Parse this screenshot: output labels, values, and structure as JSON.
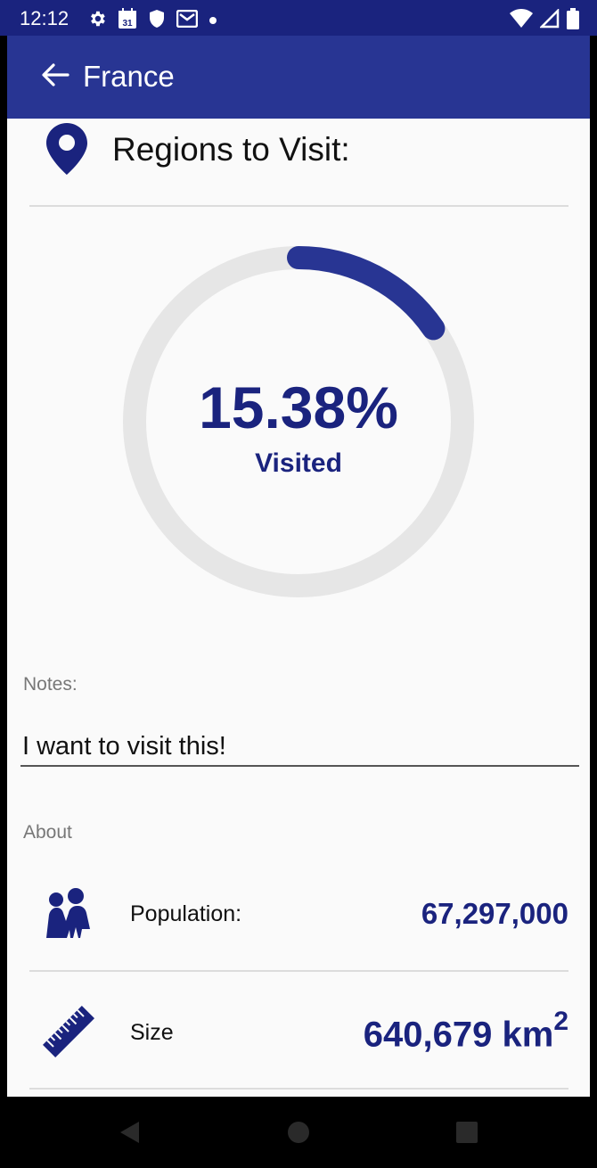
{
  "status_bar": {
    "time": "12:12",
    "calendar_day": "31",
    "left_icons": [
      "gear-icon",
      "calendar-icon",
      "shield-icon",
      "mail-icon",
      "dot-icon"
    ],
    "right_icons": [
      "wifi-icon",
      "signal-icon",
      "battery-icon"
    ]
  },
  "app_bar": {
    "title": "France"
  },
  "section": {
    "title": "Regions to Visit:"
  },
  "progress": {
    "percent_text": "15.38%",
    "label": "Visited",
    "fraction": 0.1538,
    "color": "#283593",
    "track_color": "#e6e6e6"
  },
  "notes": {
    "label": "Notes:",
    "value": "I want to visit this!"
  },
  "about": {
    "label": "About",
    "population": {
      "label": "Population:",
      "value": "67,297,000"
    },
    "size": {
      "label": "Size",
      "value": "640,679 km",
      "unit_sup": "2"
    }
  },
  "colors": {
    "accent": "#283593",
    "status": "#1a237e",
    "text_dark_blue": "#1a237e"
  }
}
